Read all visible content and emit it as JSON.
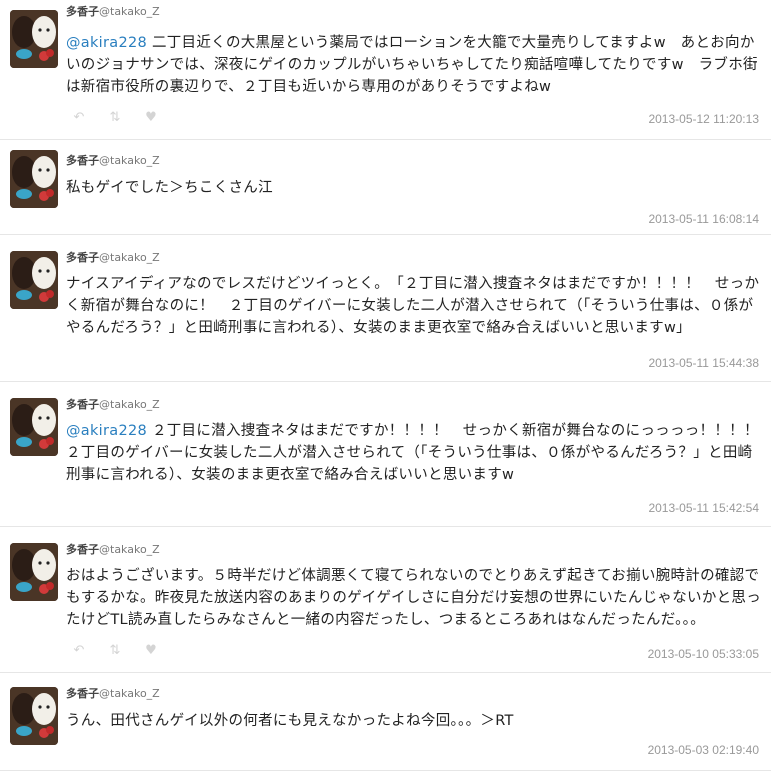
{
  "tweets": [
    {
      "name": "多香子",
      "handle": "@takako_Z",
      "mention": "@akira228",
      "text": " 二丁目近くの大黒屋という薬局ではローションを大籠で大量売りしてますよw　あとお向かいのジョナサンでは、深夜にゲイのカップルがいちゃいちゃしてたり痴話喧嘩してたりですw　ラブホ街は新宿市役所の裏辺りで、２丁目も近いから専用のがありそうですよねw",
      "time": "2013-05-12 11:20:13"
    },
    {
      "name": "多香子",
      "handle": "@takako_Z",
      "mention": "",
      "text": "私もゲイでした＞ちこくさん江",
      "time": "2013-05-11 16:08:14"
    },
    {
      "name": "多香子",
      "handle": "@takako_Z",
      "mention": "",
      "text": "ナイスアイディアなのでレスだけどツイっとく。　「２丁目に潜入捜査ネタはまだですか！！！！　せっかく新宿が舞台なのに！　２丁目のゲイバーに女装した二人が潜入させられて（「そういう仕事は、０係がやるんだろう？」と田崎刑事に言われる）、女装のまま更衣室で絡み合えばいいと思いますw」",
      "time": "2013-05-11 15:44:38"
    },
    {
      "name": "多香子",
      "handle": "@takako_Z",
      "mention": "@akira228",
      "text": " ２丁目に潜入捜査ネタはまだですか！！！！　せっかく新宿が舞台なのにっっっっ！！！！　２丁目のゲイバーに女装した二人が潜入させられて（「そういう仕事は、０係がやるんだろう？」と田崎刑事に言われる）、女装のまま更衣室で絡み合えばいいと思いますw",
      "time": "2013-05-11 15:42:54"
    },
    {
      "name": "多香子",
      "handle": "@takako_Z",
      "mention": "",
      "text": "おはようございます。５時半だけど体調悪くて寝てられないのでとりあえず起きてお揃い腕時計の確認でもするかな。昨夜見た放送内容のあまりのゲイゲイしさに自分だけ妄想の世界にいたんじゃないかと思ったけどTL読み直したらみなさんと一緒の内容だったし、つまるところあれはなんだったんだ。。。",
      "time": "2013-05-10 05:33:05"
    },
    {
      "name": "多香子",
      "handle": "@takako_Z",
      "mention": "",
      "text": "うん、田代さんゲイ以外の何者にも見えなかったよね今回。。。＞RT",
      "time": "2013-05-03 02:19:40"
    }
  ],
  "actions": {
    "reply_icon": "reply-icon",
    "retweet_icon": "retweet-icon",
    "favorite_icon": "heart-icon"
  },
  "colors": {
    "mention": "#2a7fbf",
    "timestamp": "#999999",
    "action_icon": "#d4d4d4"
  }
}
